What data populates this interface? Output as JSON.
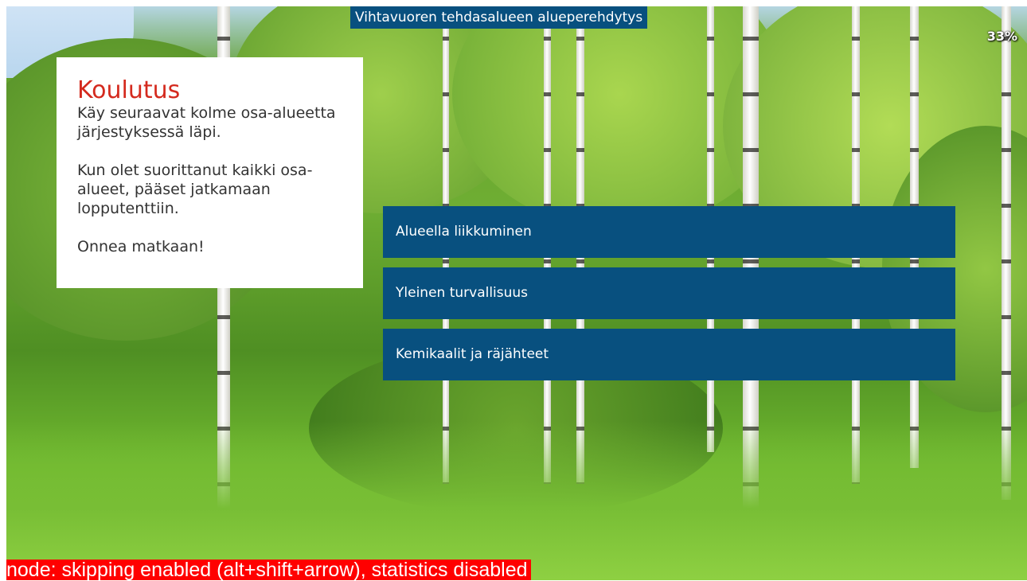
{
  "header": {
    "course_title": "Vihtavuoren tehdasalueen alueperehdytys",
    "progress": "33%"
  },
  "info_card": {
    "title": "Koulutus",
    "paragraph1": "Käy seuraavat kolme osa-alueetta järjestyksessä läpi.",
    "paragraph2": "Kun olet suorittanut kaikki osa-alueet, pääset jatkamaan lopputenttiin.",
    "paragraph3": "Onnea matkaan!"
  },
  "modules": [
    {
      "label": "Alueella liikkuminen"
    },
    {
      "label": "Yleinen turvallisuus"
    },
    {
      "label": "Kemikaalit ja räjähteet"
    }
  ],
  "mode_banner": "node: skipping enabled (alt+shift+arrow), statistics disabled",
  "colors": {
    "accent_blue": "#08507f",
    "title_red": "#d42a1e",
    "banner_red": "#ff0000"
  }
}
